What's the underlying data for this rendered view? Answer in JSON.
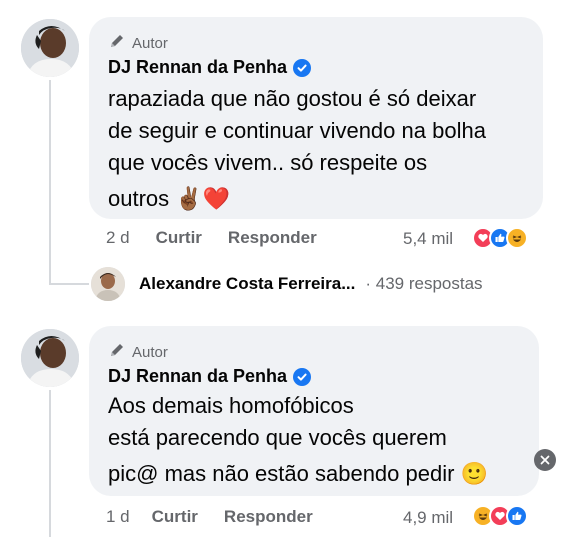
{
  "comments": [
    {
      "author_badge": "Autor",
      "author_name": "DJ Rennan da Penha",
      "lines": [
        "rapaziada que não gostou é só deixar",
        "de seguir e continuar vivendo na bolha",
        "que vocês vivem.. só respeite os",
        "outros ✌🏾❤️"
      ],
      "time": "2 d",
      "like_label": "Curtir",
      "reply_label": "Responder",
      "reaction_count": "5,4 mil",
      "reactions": [
        "love-reaction-icon",
        "like-reaction-icon",
        "haha-reaction-icon"
      ]
    },
    {
      "author_badge": "Autor",
      "author_name": "DJ Rennan da Penha",
      "lines": [
        "Aos demais homofóbicos",
        "está parecendo que vocês querem",
        "pic@ mas não estão sabendo pedir 🙂"
      ],
      "time": "1 d",
      "like_label": "Curtir",
      "reply_label": "Responder",
      "reaction_count": "4,9 mil",
      "reactions": [
        "haha-reaction-icon",
        "love-reaction-icon",
        "like-reaction-icon"
      ]
    }
  ],
  "reply_preview": {
    "name": "Alexandre Costa Ferreira...",
    "count": "· 439 respostas"
  },
  "colors": {
    "bubble": "#f0f2f5",
    "verified": "#1877f2",
    "secondary_text": "#65676b",
    "love": "#f33e58",
    "like": "#1877f2",
    "haha": "#f7b125"
  }
}
